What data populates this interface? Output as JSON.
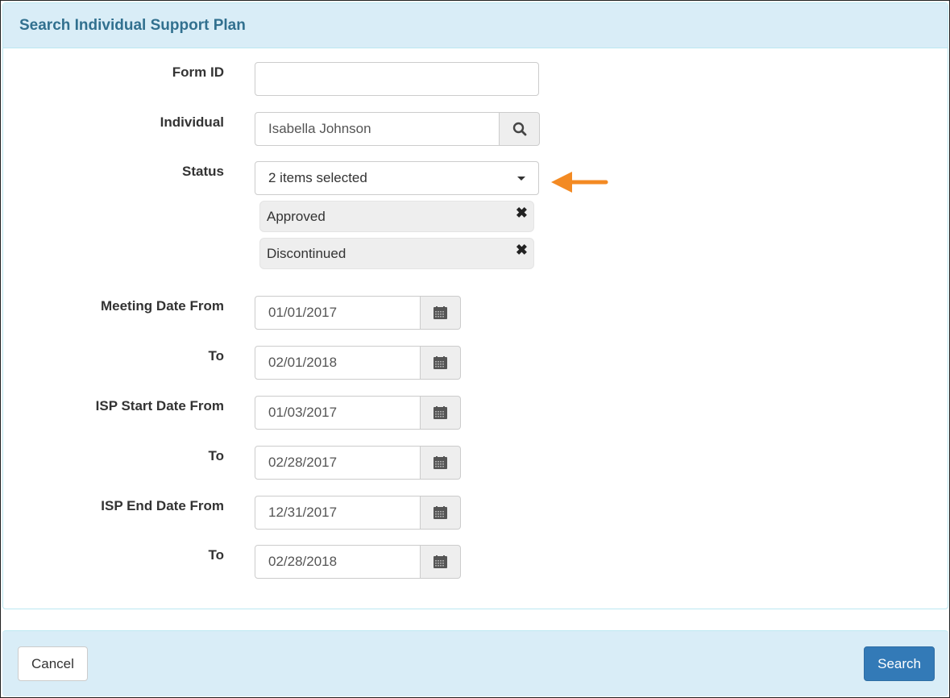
{
  "panel": {
    "title": "Search Individual Support Plan"
  },
  "form": {
    "form_id": {
      "label": "Form ID",
      "value": ""
    },
    "individual": {
      "label": "Individual",
      "value": "Isabella Johnson",
      "icon": "search-icon"
    },
    "status": {
      "label": "Status",
      "summary": "2 items selected",
      "selected": [
        {
          "label": "Approved",
          "remove": "✖"
        },
        {
          "label": "Discontinued",
          "remove": "✖"
        }
      ],
      "annotation_color": "#f38a23"
    },
    "dates": [
      {
        "label": "Meeting Date From",
        "value": "01/01/2017"
      },
      {
        "label": "To",
        "value": "02/01/2018"
      },
      {
        "label": "ISP Start Date From",
        "value": "01/03/2017"
      },
      {
        "label": "To",
        "value": "02/28/2017"
      },
      {
        "label": "ISP End Date From",
        "value": "12/31/2017"
      },
      {
        "label": "To",
        "value": "02/28/2018"
      }
    ]
  },
  "footer": {
    "cancel_label": "Cancel",
    "search_label": "Search"
  }
}
